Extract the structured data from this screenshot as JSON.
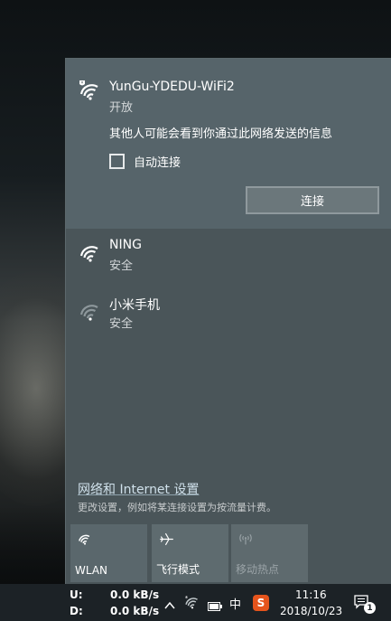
{
  "networks": {
    "active": {
      "ssid": "YunGu-YDEDU-WiFi2",
      "status": "开放",
      "warning": "其他人可能会看到你通过此网络发送的信息",
      "auto_connect_label": "自动连接",
      "auto_connect_checked": false,
      "connect_label": "连接"
    },
    "list": [
      {
        "ssid": "NING",
        "status": "安全"
      },
      {
        "ssid": "小米手机",
        "status": "安全"
      }
    ]
  },
  "settings": {
    "link": "网络和 Internet 设置",
    "description": "更改设置，例如将某连接设置为按流量计费。"
  },
  "quick_actions": [
    {
      "label": "WLAN",
      "icon": "wifi-icon",
      "enabled": true
    },
    {
      "label": "飞行模式",
      "icon": "airplane-icon",
      "enabled": true
    },
    {
      "label": "移动热点",
      "icon": "hotspot-icon",
      "enabled": false
    }
  ],
  "taskbar": {
    "upload_label": "U:",
    "upload_value": "0.0 kB/s",
    "download_label": "D:",
    "download_value": "0.0 kB/s",
    "ime": "中",
    "sogou": "S",
    "time": "11:16",
    "date": "2018/10/23",
    "notification_count": "1"
  }
}
